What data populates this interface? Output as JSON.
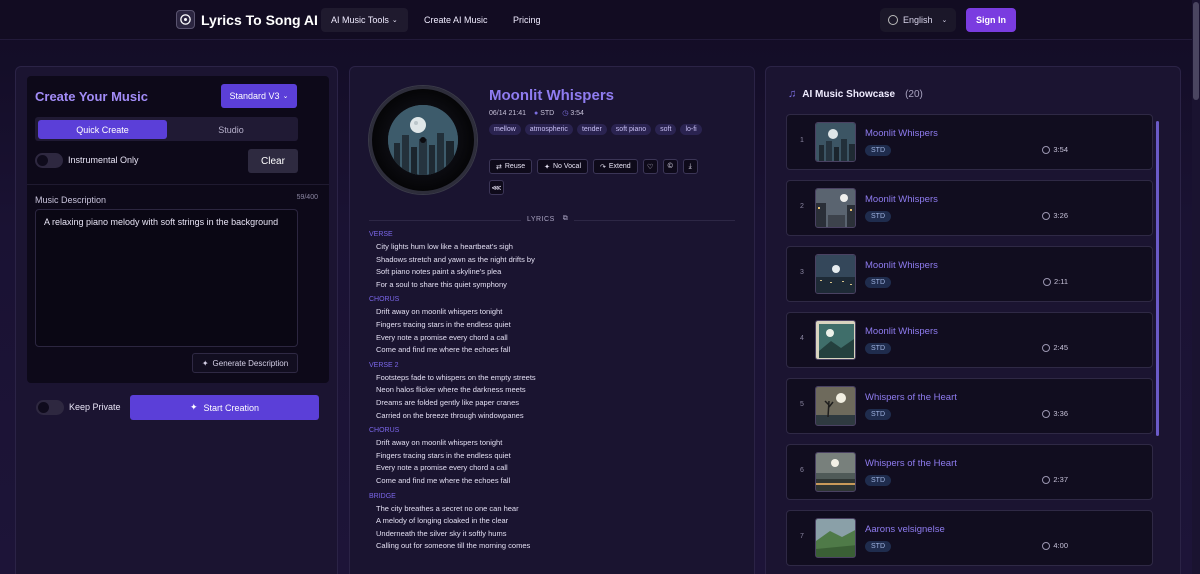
{
  "header": {
    "brand": "Lyrics To Song AI",
    "nav": [
      {
        "label": "AI Music Tools"
      },
      {
        "label": "Create AI Music"
      },
      {
        "label": "Pricing"
      }
    ],
    "language": "English",
    "signin": "Sign In"
  },
  "create": {
    "title": "Create Your Music",
    "model": "Standard V3",
    "tabs": [
      "Quick Create",
      "Studio"
    ],
    "active_tab": "Quick Create",
    "instrumental_label": "Instrumental Only",
    "instrumental_on": false,
    "clear": "Clear",
    "desc_label": "Music Description",
    "desc_count": "59/400",
    "desc_value": "A relaxing piano melody with soft strings in the background",
    "gen_desc": "Generate Description",
    "keep_private": "Keep Private",
    "keep_private_on": false,
    "start": "Start Creation"
  },
  "song": {
    "title": "Moonlit Whispers",
    "date": "06/14 21:41",
    "model": "STD",
    "duration": "3:54",
    "tags": [
      "mellow",
      "atmospheric",
      "tender",
      "soft piano",
      "soft",
      "lo-fi"
    ],
    "actions": [
      "Reuse",
      "No Vocal",
      "Extend"
    ],
    "lyrics_label": "LYRICS",
    "sections": [
      {
        "label": "VERSE",
        "lines": [
          "City lights hum low like a heartbeat's sigh",
          "Shadows stretch and yawn as the night drifts by",
          "Soft piano notes paint a skyline's plea",
          "For a soul to share this quiet symphony"
        ]
      },
      {
        "label": "CHORUS",
        "lines": [
          "Drift away on moonlit whispers tonight",
          "Fingers tracing stars in the endless quiet",
          "Every note a promise every chord a call",
          "Come and find me where the echoes fall"
        ]
      },
      {
        "label": "VERSE 2",
        "lines": [
          "Footsteps fade to whispers on the empty streets",
          "Neon halos flicker where the darkness meets",
          "Dreams are folded gently like paper cranes",
          "Carried on the breeze through windowpanes"
        ]
      },
      {
        "label": "CHORUS",
        "lines": [
          "Drift away on moonlit whispers tonight",
          "Fingers tracing stars in the endless quiet",
          "Every note a promise every chord a call",
          "Come and find me where the echoes fall"
        ]
      },
      {
        "label": "BRIDGE",
        "lines": [
          "The city breathes a secret no one can hear",
          "A melody of longing cloaked in the clear",
          "Underneath the silver sky it softly hums",
          "Calling out for someone till the morning comes"
        ]
      }
    ]
  },
  "showcase": {
    "title": "AI Music Showcase",
    "count": "(20)",
    "items": [
      {
        "num": "1",
        "name": "Moonlit Whispers",
        "badge": "STD",
        "duration": "3:54"
      },
      {
        "num": "2",
        "name": "Moonlit Whispers",
        "badge": "STD",
        "duration": "3:26"
      },
      {
        "num": "3",
        "name": "Moonlit Whispers",
        "badge": "STD",
        "duration": "2:11"
      },
      {
        "num": "4",
        "name": "Moonlit Whispers",
        "badge": "STD",
        "duration": "2:45"
      },
      {
        "num": "5",
        "name": "Whispers of the Heart",
        "badge": "STD",
        "duration": "3:36"
      },
      {
        "num": "6",
        "name": "Whispers of the Heart",
        "badge": "STD",
        "duration": "2:37"
      },
      {
        "num": "7",
        "name": "Aarons velsignelse",
        "badge": "STD",
        "duration": "4:00"
      }
    ]
  },
  "colors": {
    "accent": "#5b3fd8",
    "title_purple": "#8f7cf0",
    "signin": "#7a3ce0",
    "background": "#1a1233"
  }
}
